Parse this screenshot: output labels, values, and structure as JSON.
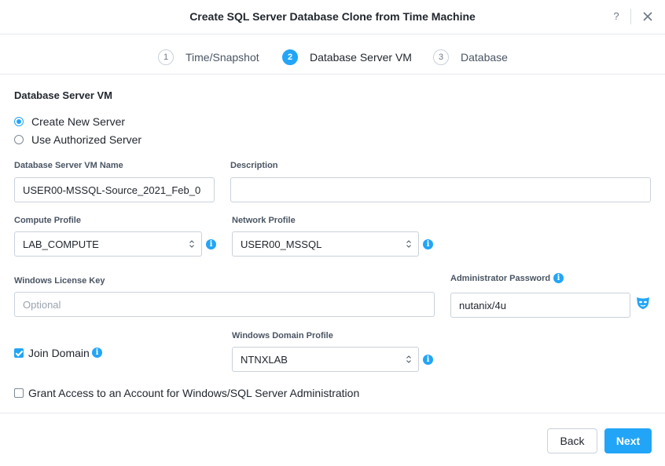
{
  "dialog": {
    "title": "Create SQL Server Database Clone from Time Machine",
    "help_label": "?",
    "close_icon": "close-icon"
  },
  "steps": [
    {
      "number": "1",
      "label": "Time/Snapshot",
      "active": false
    },
    {
      "number": "2",
      "label": "Database Server VM",
      "active": true
    },
    {
      "number": "3",
      "label": "Database",
      "active": false
    }
  ],
  "form": {
    "section_title": "Database Server VM",
    "server_options": [
      {
        "label": "Create New Server",
        "selected": true
      },
      {
        "label": "Use Authorized Server",
        "selected": false
      }
    ],
    "vm_name": {
      "label": "Database Server VM Name",
      "value": "USER00-MSSQL-Source_2021_Feb_0"
    },
    "description": {
      "label": "Description",
      "value": ""
    },
    "compute_profile": {
      "label": "Compute Profile",
      "value": "LAB_COMPUTE"
    },
    "network_profile": {
      "label": "Network Profile",
      "value": "USER00_MSSQL"
    },
    "license_key": {
      "label": "Windows License Key",
      "value": "",
      "placeholder": "Optional"
    },
    "admin_password": {
      "label": "Administrator Password",
      "value": "nutanix/4u"
    },
    "join_domain": {
      "label": "Join Domain",
      "checked": true
    },
    "domain_profile": {
      "label": "Windows Domain Profile",
      "value": "NTNXLAB"
    },
    "grant_access": {
      "label": "Grant Access to an Account for Windows/SQL Server Administration",
      "checked": false
    },
    "info_glyph": "i"
  },
  "footer": {
    "back_label": "Back",
    "next_label": "Next"
  },
  "colors": {
    "accent": "#22a5f7",
    "border": "#c9d1da",
    "text": "#22272e"
  }
}
